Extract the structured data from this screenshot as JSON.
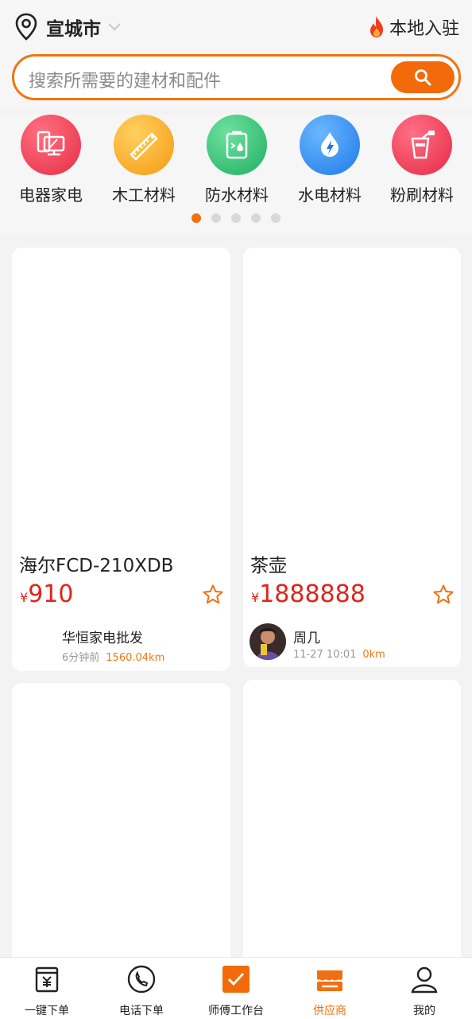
{
  "header": {
    "city": "宣城市",
    "entry_label": "本地入驻"
  },
  "search": {
    "placeholder": "搜索所需要的建材和配件"
  },
  "categories": [
    {
      "label": "电器家电",
      "icon": "appliance-icon",
      "color": "#f04256"
    },
    {
      "label": "木工材料",
      "icon": "saw-icon",
      "color": "#f7a41c"
    },
    {
      "label": "防水材料",
      "icon": "waterproof-bucket-icon",
      "color": "#2fbf6c"
    },
    {
      "label": "水电材料",
      "icon": "water-drop-bolt-icon",
      "color": "#2b8cf0"
    },
    {
      "label": "粉刷材料",
      "icon": "paint-bucket-icon",
      "color": "#f03d55"
    }
  ],
  "carousel": {
    "pages": 5,
    "active_page": 1
  },
  "products": [
    {
      "title": "海尔FCD-210XDB",
      "currency": "¥",
      "price": "910",
      "seller": "华恒家电批发",
      "time": "6分钟前",
      "distance": "1560.04km"
    },
    {
      "title": "茶壶",
      "currency": "¥",
      "price": "1888888",
      "seller": "周几",
      "time": "11-27 10:01",
      "distance": "0km"
    }
  ],
  "tabbar": [
    {
      "label": "一键下单",
      "icon": "order-receipt-icon",
      "active": false
    },
    {
      "label": "电话下单",
      "icon": "phone-icon",
      "active": false
    },
    {
      "label": "师傅工作台",
      "icon": "checkbox-icon",
      "active": false
    },
    {
      "label": "供应商",
      "icon": "store-icon",
      "active": true
    },
    {
      "label": "我的",
      "icon": "user-icon",
      "active": false
    }
  ],
  "colors": {
    "accent": "#f07010",
    "price": "#e2231a",
    "page_bg": "#f3f3f3"
  }
}
